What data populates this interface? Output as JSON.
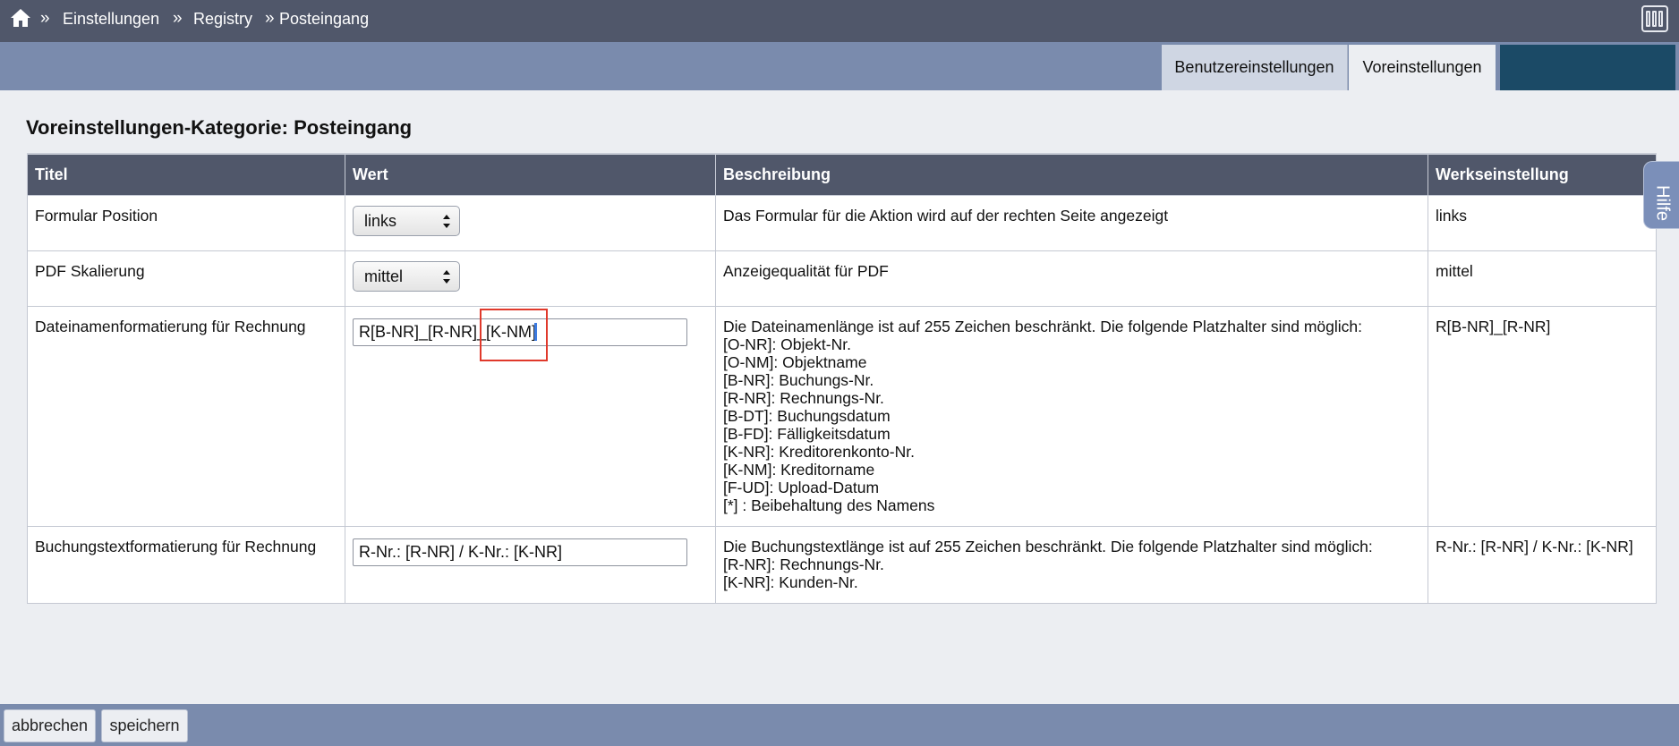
{
  "breadcrumb": {
    "home_icon": "home-icon",
    "separator": "»",
    "items": [
      "Einstellungen",
      "Registry",
      "Posteingang"
    ]
  },
  "tabs": {
    "user_settings": "Benutzereinstellungen",
    "presets": "Voreinstellungen",
    "active_color": "#1b4a66"
  },
  "page": {
    "heading": "Voreinstellungen-Kategorie: Posteingang"
  },
  "table": {
    "headers": {
      "title": "Titel",
      "value": "Wert",
      "description": "Beschreibung",
      "default": "Werkseinstellung"
    },
    "rows": [
      {
        "title": "Formular Position",
        "value": "links",
        "description": "Das Formular für die Aktion wird auf der rechten Seite angezeigt",
        "default": "links"
      },
      {
        "title": "PDF Skalierung",
        "value": "mittel",
        "description": "Anzeigequalität für PDF",
        "default": "mittel"
      },
      {
        "title": "Dateinamenformatierung für Rechnung",
        "value": "R[B-NR]_[R-NR]_[K-NM]",
        "description_lines": [
          "Die Dateinamenlänge ist auf 255 Zeichen beschränkt. Die folgende Platzhalter sind möglich:",
          "[O-NR]: Objekt-Nr.",
          "[O-NM]: Objektname",
          "[B-NR]: Buchungs-Nr.",
          "[R-NR]: Rechnungs-Nr.",
          "[B-DT]: Buchungsdatum",
          "[B-FD]: Fälligkeitsdatum",
          "[K-NR]: Kreditorenkonto-Nr.",
          "[K-NM]: Kreditorname",
          "[F-UD]: Upload-Datum",
          "[*] : Beibehaltung des Namens"
        ],
        "default": "R[B-NR]_[R-NR]"
      },
      {
        "title": "Buchungstextformatierung für Rechnung",
        "value": "R-Nr.: [R-NR] / K-Nr.: [K-NR]",
        "description_lines": [
          "Die Buchungstextlänge ist auf 255 Zeichen beschränkt. Die folgende Platzhalter sind möglich:",
          "[R-NR]: Rechnungs-Nr.",
          "[K-NR]: Kunden-Nr."
        ],
        "default": "R-Nr.: [R-NR] / K-Nr.: [K-NR]"
      }
    ]
  },
  "help_tab": {
    "label": "Hilfe"
  },
  "footer": {
    "cancel_label": "abbrechen",
    "save_label": "speichern"
  }
}
